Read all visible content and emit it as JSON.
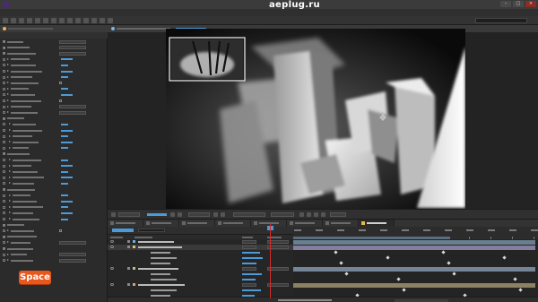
{
  "brand": {
    "watermark": "aeplug.ru"
  },
  "window": {
    "title": ""
  },
  "menu": {
    "items": []
  },
  "toolbar": {
    "snapping_label": ""
  },
  "overlay": {
    "key_label": "Space"
  },
  "colors": {
    "accent_blue": "#4c9bd9",
    "playhead_red": "#d42b2b",
    "space_key_orange": "#e8571b"
  },
  "icons": {
    "window_buttons": [
      "minimize-icon",
      "maximize-icon",
      "close-icon"
    ],
    "window_glyphs": [
      "–",
      "□",
      "×"
    ],
    "tool_count": 14
  },
  "effect_controls": {
    "rows": 38
  },
  "timeline": {
    "tabs": 8,
    "layer_rows": 11
  }
}
